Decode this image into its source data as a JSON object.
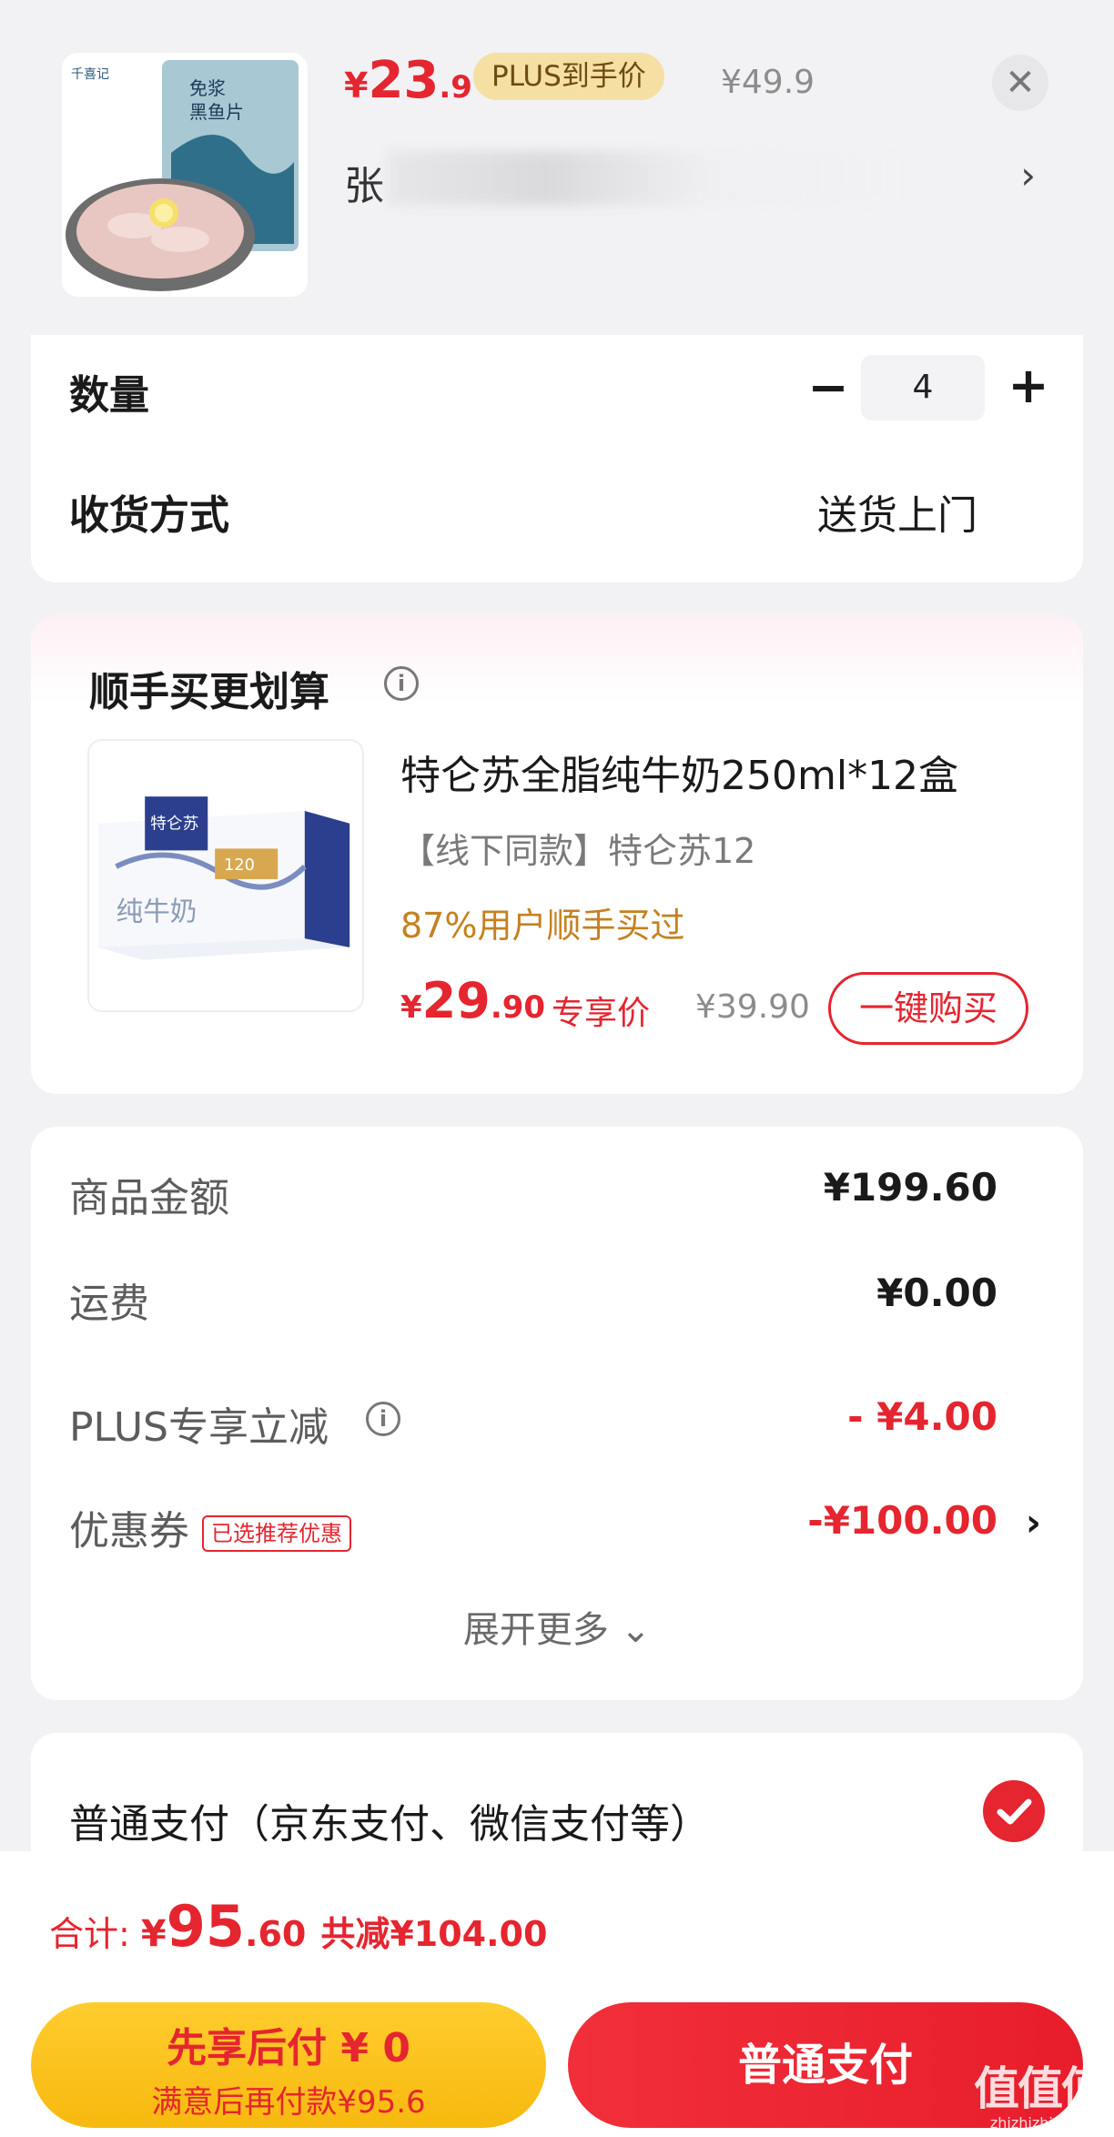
{
  "product": {
    "price_symbol": "¥",
    "price_int": "23",
    "price_dec": ".9",
    "plus_badge": "PLUS到手价",
    "original_price": "¥49.9",
    "close_icon": "close-icon",
    "address": "张",
    "address_chevron": "›",
    "image_brand": "千喜记",
    "image_label_1": "免浆",
    "image_label_2": "黑鱼片"
  },
  "quantity": {
    "label": "数量",
    "minus": "−",
    "value": "4",
    "plus": "+"
  },
  "delivery": {
    "label": "收货方式",
    "value": "送货上门"
  },
  "upsell": {
    "title": "顺手买更划算",
    "info_icon": "i",
    "name": "特仑苏全脂纯牛奶250ml*12盒",
    "subtitle": "【线下同款】特仑苏12",
    "users": "87%用户顺手买过",
    "price_symbol": "¥",
    "price_int": "29",
    "price_dec": ".90",
    "exclusive_label": "专享价",
    "original_price": "¥39.90",
    "buy_button": "一键购买",
    "image_brand": "特仑苏",
    "image_text": "纯牛奶",
    "image_number": "120"
  },
  "summary": {
    "rows": [
      {
        "label": "商品金额",
        "value": "¥199.60"
      },
      {
        "label": "运费",
        "value": "¥0.00"
      },
      {
        "label": "PLUS专享立减",
        "value": "- ¥4.00"
      },
      {
        "label": "优惠券",
        "value": "-¥100.00"
      }
    ],
    "coupon_tag": "已选推荐优惠",
    "info_icon": "i",
    "coupon_chevron": "›",
    "expand_more": "展开更多 ⌄"
  },
  "payment": {
    "label": "普通支付（京东支付、微信支付等）"
  },
  "footer": {
    "total_label": "合计: ",
    "total_symbol": "¥",
    "total_int": "95",
    "total_dec": ".60",
    "saved": "共减¥104.00",
    "later_line1": "先享后付 ¥ 0",
    "later_line2": "满意后再付款¥95.6",
    "pay_button": "普通支付"
  },
  "watermark": {
    "big": "值值值",
    "small": "zhizhizhi.com"
  },
  "colors": {
    "accent_red": "#e5252f",
    "plus_gold": "#f5dfa3",
    "users_orange": "#c5811f",
    "later_yellow": "#ffcd2e"
  }
}
